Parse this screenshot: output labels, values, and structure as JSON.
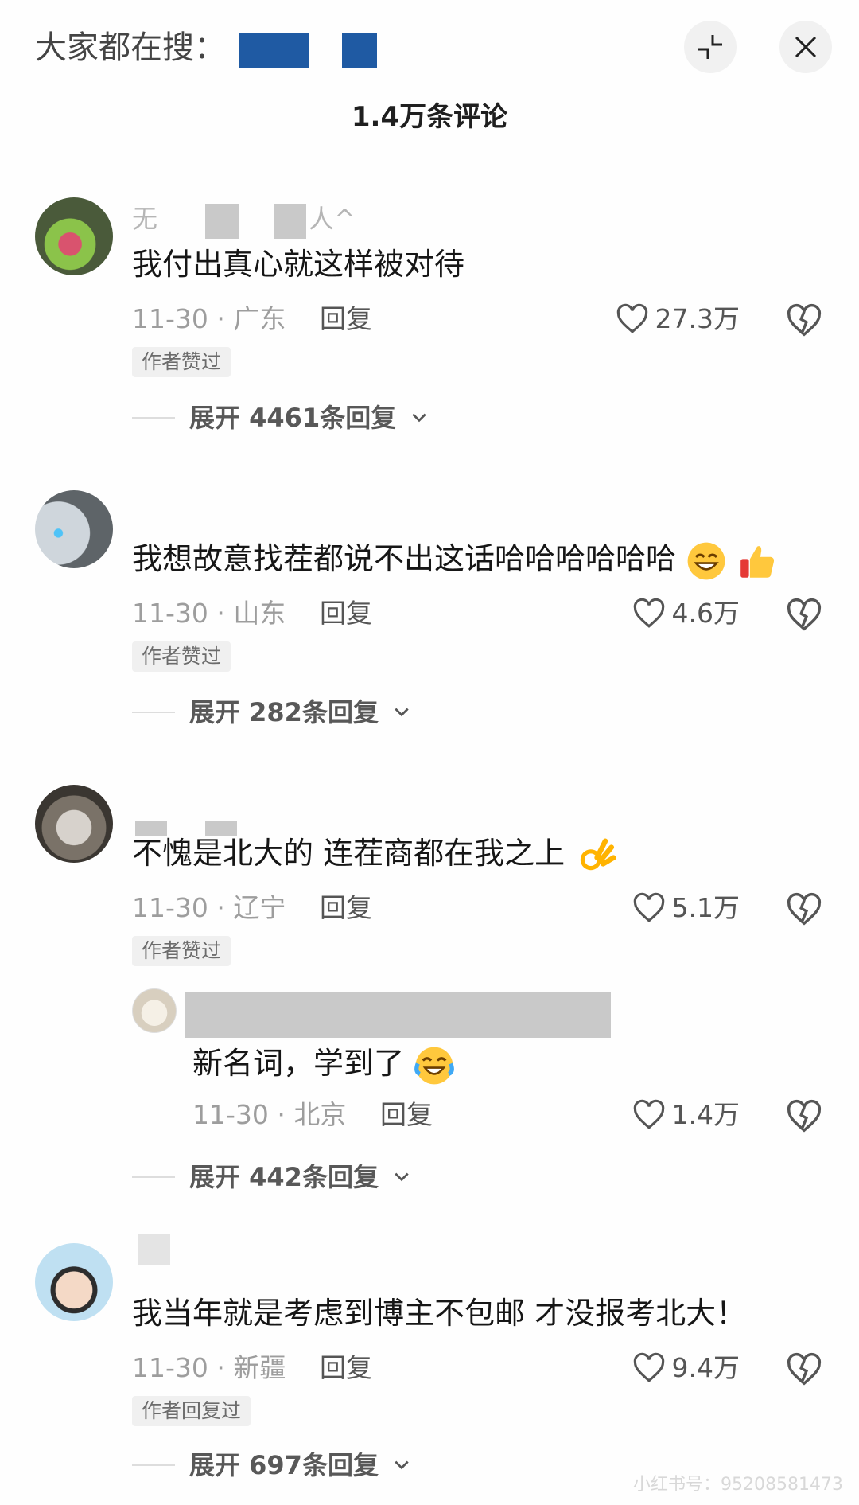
{
  "header": {
    "search_prefix": "大家都在搜：",
    "comment_count": "1.4万条评论"
  },
  "comments": [
    {
      "username_fragment_left": "无",
      "username_fragment_right": "人^",
      "text": "我付出真心就这样被对待",
      "date_location": "11-30 · 广东",
      "reply_label": "回复",
      "likes": "27.3万",
      "badge": "作者赞过",
      "expand_label": "展开 4461条回复"
    },
    {
      "text": "我想故意找茬都说不出这话哈哈哈哈哈哈",
      "date_location": "11-30 · 山东",
      "reply_label": "回复",
      "likes": "4.6万",
      "badge": "作者赞过",
      "expand_label": "展开 282条回复"
    },
    {
      "text": "不愧是北大的 连茬商都在我之上",
      "date_location": "11-30 · 辽宁",
      "reply_label": "回复",
      "likes": "5.1万",
      "badge": "作者赞过",
      "reply": {
        "text": "新名词，学到了",
        "date_location": "11-30 · 北京",
        "reply_label": "回复",
        "likes": "1.4万"
      },
      "expand_label": "展开 442条回复"
    },
    {
      "text": "我当年就是考虑到博主不包邮 才没报考北大！",
      "date_location": "11-30 · 新疆",
      "reply_label": "回复",
      "likes": "9.4万",
      "badge": "作者回复过",
      "expand_label": "展开 697条回复"
    }
  ],
  "watermark": "小红书号：95208581473",
  "icons": {
    "minimize": "collapse-icon",
    "close": "close-icon",
    "like": "heart-outline-icon",
    "dislike": "broken-heart-icon",
    "expand": "chevron-down-icon"
  },
  "colors": {
    "redaction_blue": "#1f5aa3",
    "redaction_gray": "#c9c9c9"
  }
}
